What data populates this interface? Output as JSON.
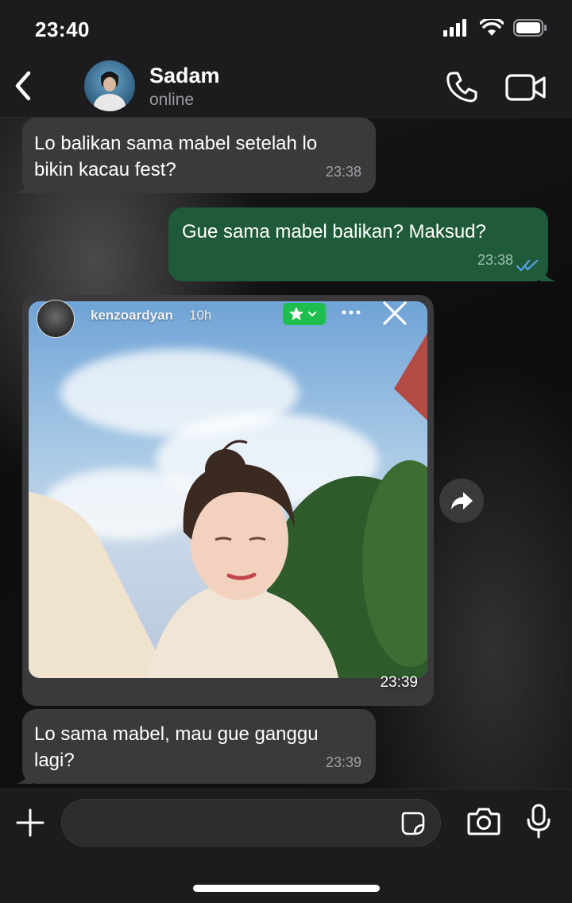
{
  "status_bar": {
    "time": "23:40"
  },
  "header": {
    "contact_name": "Sadam",
    "presence": "online"
  },
  "messages": [
    {
      "direction": "incoming",
      "text_line1": "Lo balikan sama mabel setelah lo",
      "text_line2": "bikin kacau fest?",
      "time": "23:38"
    },
    {
      "direction": "outgoing",
      "text": "Gue sama mabel balikan? Maksud?",
      "time": "23:38",
      "read_receipt": "double-check-icon"
    },
    {
      "direction": "incoming",
      "type": "story_reply",
      "story_username": "kenzoardyan",
      "story_age": "10h",
      "time": "23:39"
    },
    {
      "direction": "incoming",
      "text_line1": "Lo sama mabel, mau gue ganggu",
      "text_line2": "lagi?",
      "time": "23:39"
    }
  ],
  "colors": {
    "incoming_bubble": "#3a3a3c",
    "outgoing_bubble": "#1f5b3a",
    "read_tick": "#5aa0e6",
    "close_friends_badge": "#1fbf4f"
  }
}
